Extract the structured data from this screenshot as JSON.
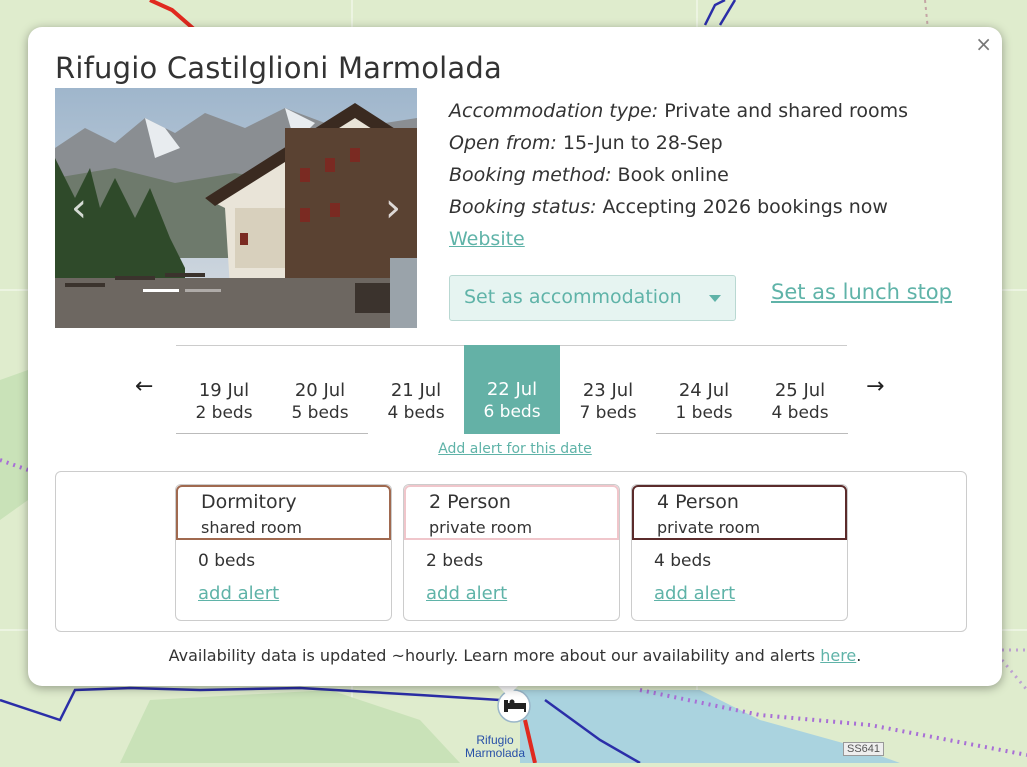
{
  "popup": {
    "title": "Rifugio Castilglioni Marmolada",
    "close_icon": "×",
    "info": {
      "accommodation_type_label": "Accommodation type:",
      "accommodation_type_value": "Private and shared rooms",
      "open_from_label": "Open from:",
      "open_from_value": "15-Jun to 28-Sep",
      "booking_method_label": "Booking method:",
      "booking_method_value": "Book online",
      "booking_status_label": "Booking status:",
      "booking_status_value": "Accepting 2026 bookings now",
      "website_link": "Website"
    },
    "accommodation_select": {
      "selected": "Set as accommodation"
    },
    "lunch_link": "Set as lunch stop",
    "carousel": {
      "prev_icon": "‹",
      "next_icon": "›"
    },
    "dates": {
      "prev_icon": "←",
      "next_icon": "→",
      "items": [
        {
          "date": "19 Jul",
          "beds": "2 beds",
          "active": false
        },
        {
          "date": "20 Jul",
          "beds": "5 beds",
          "active": false
        },
        {
          "date": "21 Jul",
          "beds": "4 beds",
          "active": false
        },
        {
          "date": "22 Jul",
          "beds": "6 beds",
          "active": true
        },
        {
          "date": "23 Jul",
          "beds": "7 beds",
          "active": false
        },
        {
          "date": "24 Jul",
          "beds": "1 beds",
          "active": false
        },
        {
          "date": "25 Jul",
          "beds": "4 beds",
          "active": false
        }
      ],
      "add_alert_label": "Add alert for this date"
    },
    "rooms": [
      {
        "name": "Dormitory",
        "type": "shared room",
        "beds": "0 beds",
        "alert_label": "add alert",
        "color": "#a0694f"
      },
      {
        "name": "2 Person",
        "type": "private room",
        "beds": "2 beds",
        "alert_label": "add alert",
        "color": "#f0c6cb"
      },
      {
        "name": "4 Person",
        "type": "private room",
        "beds": "4 beds",
        "alert_label": "add alert",
        "color": "#5b2b2b"
      }
    ],
    "footer": {
      "text": "Availability data is updated ~hourly. Learn more about our availability and alerts ",
      "link": "here",
      "suffix": "."
    }
  },
  "map": {
    "marker_icon": "bed-icon",
    "place_label_1": "Rifugio",
    "place_label_2": "Marmolada",
    "road_shield": "SS641"
  },
  "colors": {
    "accent": "#5fb3a8",
    "active_date": "#64b1a6",
    "map_bg": "#dfeccd",
    "lake": "#aad3df"
  }
}
